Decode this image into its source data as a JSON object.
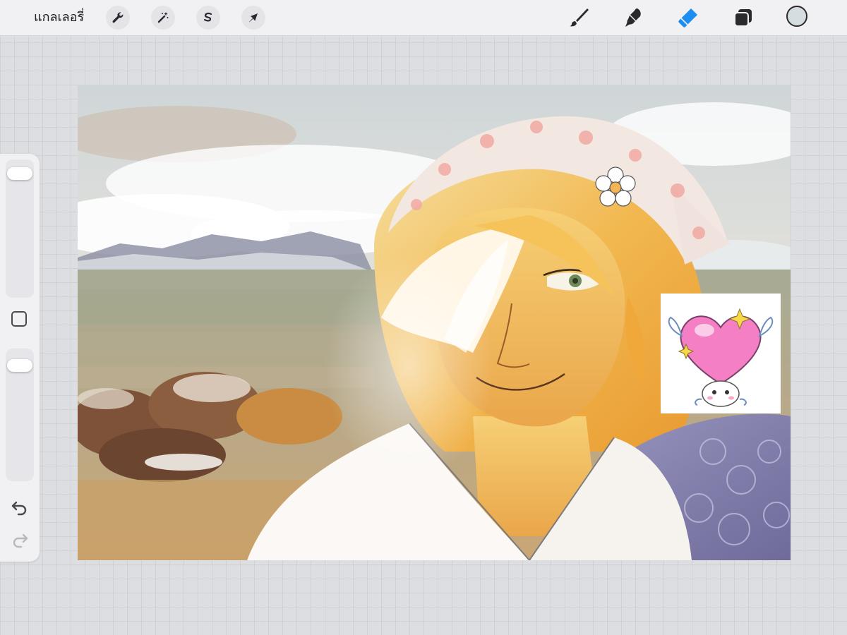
{
  "topbar": {
    "gallery_label": "แกลเลอรี่",
    "left_tools": [
      "wrench-icon",
      "magic-wand-icon",
      "selection-icon",
      "transform-arrow-icon"
    ],
    "right_tools": [
      "brush-icon",
      "smudge-icon",
      "eraser-icon",
      "layers-icon"
    ],
    "active_tool": "eraser",
    "current_color": "#d6dde0",
    "accent_color": "#1e8cf0"
  },
  "sidebar": {
    "brush_size_level": 0.96,
    "opacity_level": 0.93,
    "icons": [
      "modify-square-icon",
      "undo-icon",
      "redo-icon"
    ]
  }
}
